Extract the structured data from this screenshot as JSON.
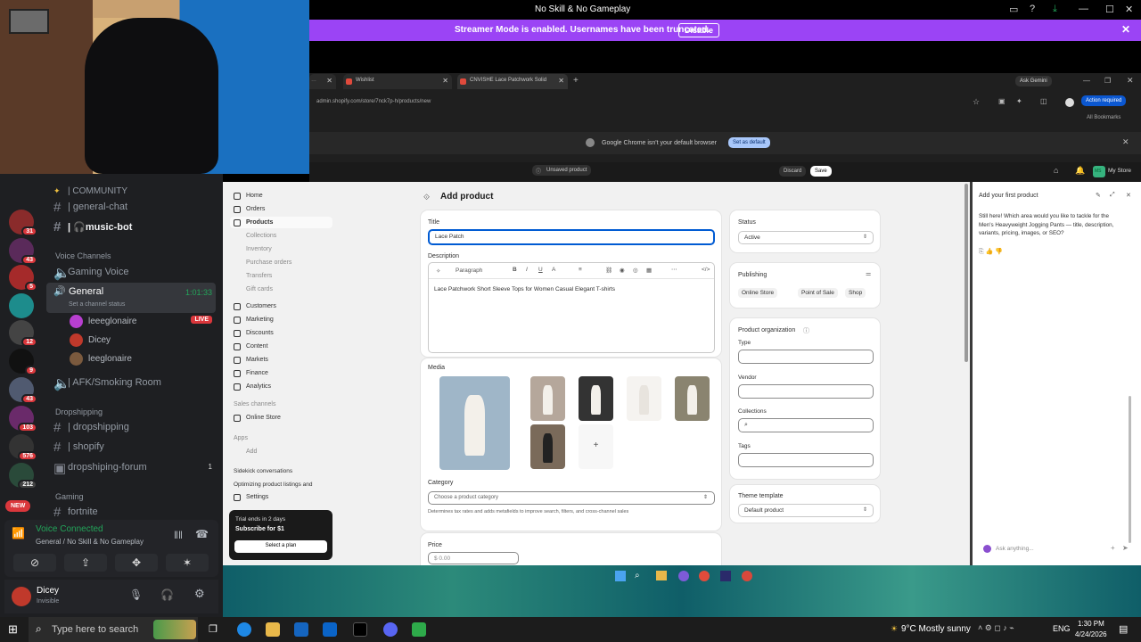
{
  "window": {
    "title": "No Skill & No Gameplay"
  },
  "banner": {
    "message": "Streamer Mode is enabled. Usernames have been truncated.",
    "button": "Disable"
  },
  "browser": {
    "tabs": [
      {
        "label": "Wishlist"
      },
      {
        "label": "CNVISHE Lace Patchwork Solid"
      }
    ],
    "new_tab": "+",
    "gemini": "Ask Gemini",
    "url": "admin.shopify.com/store/7nck7p-h/products/new",
    "action_required": "Action required",
    "bookmarks": "All Bookmarks",
    "notice": "Google Chrome isn't your default browser",
    "notice_button": "Set as default"
  },
  "shopify_bar": {
    "status": "Unsaved product",
    "discard": "Discard",
    "save": "Save",
    "store": "My Store",
    "store_initials": "MS"
  },
  "discord": {
    "guilds": [
      {
        "badge": "31"
      },
      {
        "badge": "43"
      },
      {
        "badge": "5"
      },
      {
        "badge": ""
      },
      {
        "badge": "12"
      },
      {
        "badge": "9"
      },
      {
        "badge": "43"
      },
      {
        "badge": "103"
      },
      {
        "badge": "576"
      },
      {
        "badge": "212"
      }
    ],
    "new_label": "NEW",
    "categories": {
      "community": "| COMMUNITY",
      "voice": "Voice Channels",
      "dropshipping": "Dropshipping",
      "gaming": "Gaming"
    },
    "channels": {
      "general_chat": "| general-chat",
      "music_bot": "| 🎧music-bot",
      "gaming_voice": "Gaming Voice",
      "general": "General",
      "general_time": "1:01:33",
      "channel_status": "Set a channel status",
      "afk": "| AFK/Smoking Room",
      "dropshipping": "| dropshipping",
      "shopify": "| shopify",
      "forum": "dropshiping-forum",
      "forum_count": "1",
      "fortnite": "fortnite"
    },
    "voice_users": [
      {
        "name": "leeeglonaire",
        "live": "LIVE"
      },
      {
        "name": "Dicey"
      },
      {
        "name": "leeglonaire"
      }
    ],
    "voice_panel": {
      "title": "Voice Connected",
      "subtitle": "General / No Skill & No Gameplay"
    },
    "user": {
      "name": "Dicey",
      "status": "Invisible"
    }
  },
  "shopify": {
    "nav": [
      "Home",
      "Orders",
      "Products"
    ],
    "products_sub": [
      "Collections",
      "Inventory",
      "Purchase orders",
      "Transfers",
      "Gift cards"
    ],
    "nav2": [
      "Customers",
      "Marketing",
      "Discounts",
      "Content",
      "Markets",
      "Finance",
      "Analytics"
    ],
    "sales_channels": "Sales channels",
    "online_store": "Online Store",
    "apps": "Apps",
    "add": "Add",
    "sidekick": "Sidekick conversations",
    "optimizing": "Optimizing product listings and",
    "settings": "Settings",
    "trial": {
      "line1": "Trial ends in 2 days",
      "line2": "Subscribe for $1",
      "button": "Select a plan"
    },
    "page_title": "Add product",
    "title_label": "Title",
    "title_value": "Lace Patch",
    "description_label": "Description",
    "paragraph": "Paragraph",
    "description_text": "Lace Patchwork Short Sleeve Tops for Women Casual Elegant T-shirts",
    "media_label": "Media",
    "category_label": "Category",
    "category_placeholder": "Choose a product category",
    "category_help": "Determines tax rates and adds metafields to improve search, filters, and cross-channel sales",
    "price_label": "Price",
    "price_value": "$ 0.00",
    "status_label": "Status",
    "status_value": "Active",
    "publishing_label": "Publishing",
    "publishing_tags": [
      "Online Store",
      "Point of Sale",
      "Shop"
    ],
    "org_label": "Product organization",
    "org_fields": [
      "Type",
      "Vendor",
      "Collections",
      "Tags"
    ],
    "theme_label": "Theme template",
    "theme_value": "Default product"
  },
  "assistant": {
    "title": "Add your first product",
    "message": "Still here! Which area would you like to tackle for the Men's Heavyweight Jogging Pants — title, description, variants, pricing, images, or SEO?",
    "input_placeholder": "Ask anything..."
  },
  "taskbar": {
    "search": "Type here to search",
    "weather": "9°C  Mostly sunny",
    "lang": "ENG",
    "time": "1:30 PM",
    "date": "4/24/2026"
  },
  "colors": {
    "banner": "#9b44f5",
    "discord_bg": "#1e1f22",
    "voice_green": "#23a55a",
    "live_red": "#da373c"
  }
}
